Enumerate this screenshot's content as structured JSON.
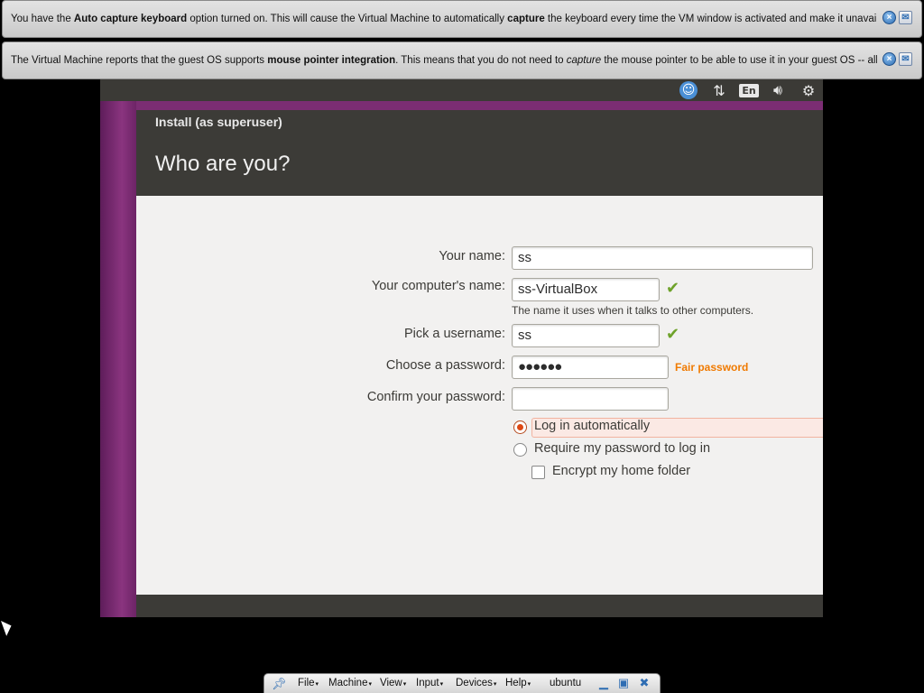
{
  "notifications": [
    {
      "prefix": "You have the ",
      "bold1": "Auto capture keyboard",
      "mid": " option turned on. This will cause the Virtual Machine to automatically ",
      "bold2": "capture",
      "suffix": " the keyboard every time the VM window is activated and make it unavailable to"
    },
    {
      "prefix": "The Virtual Machine reports that the guest OS supports ",
      "bold1": "mouse pointer integration",
      "mid": ". This means that you do not need to ",
      "italic": "capture",
      "suffix": " the mouse pointer to be able to use it in your guest OS -- all mouse"
    }
  ],
  "tray": {
    "language": "En"
  },
  "installer": {
    "window_title": "Install (as superuser)",
    "heading": "Who are you?",
    "your_name_label": "Your name:",
    "your_name_value": "ss",
    "computer_name_label": "Your computer's name:",
    "computer_name_value": "ss-VirtualBox",
    "computer_name_hint": "The name it uses when it talks to other computers.",
    "username_label": "Pick a username:",
    "username_value": "ss",
    "password_label": "Choose a password:",
    "password_value": "●●●●●●",
    "password_strength": "Fair password",
    "confirm_label": "Confirm your password:",
    "confirm_value": "",
    "option_auto_login": "Log in automatically",
    "option_require_password": "Require my password to log in",
    "option_encrypt": "Encrypt my home folder",
    "check_mark": "✔"
  },
  "mini_toolbar": {
    "menus": [
      "File",
      "Machine",
      "View",
      "Input",
      "Devices",
      "Help"
    ],
    "vm_name": "ubuntu"
  },
  "colors": {
    "ubuntu_orange": "#dd4814",
    "check_green": "#6ea22a",
    "strength_orange": "#f07a00"
  }
}
